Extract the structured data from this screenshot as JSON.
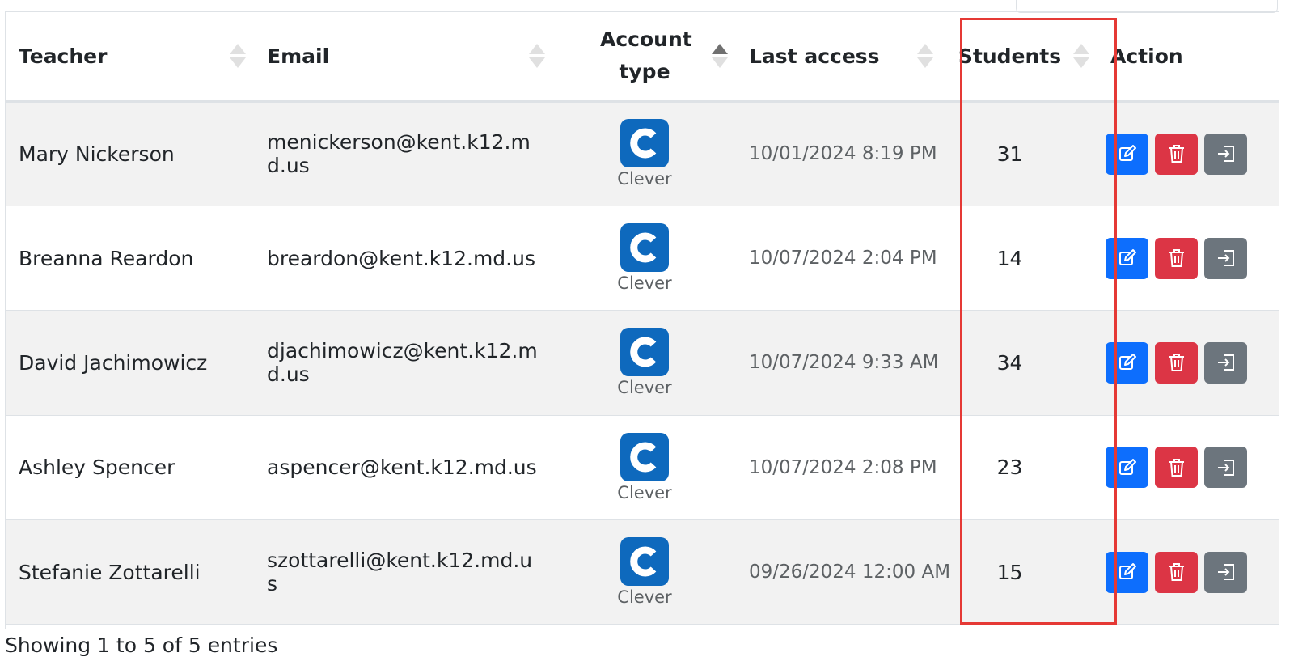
{
  "table": {
    "columns": [
      {
        "label": "Teacher"
      },
      {
        "label": "Email"
      },
      {
        "label": "Account type"
      },
      {
        "label": "Last access"
      },
      {
        "label": "Students"
      },
      {
        "label": "Action"
      }
    ],
    "rows": [
      {
        "teacher": "Mary Nickerson",
        "email": "menickerson@kent.k12.md.us",
        "account_type": "Clever",
        "last_access": "10/01/2024 8:19 PM",
        "students": "31"
      },
      {
        "teacher": "Breanna Reardon",
        "email": "breardon@kent.k12.md.us",
        "account_type": "Clever",
        "last_access": "10/07/2024 2:04 PM",
        "students": "14"
      },
      {
        "teacher": "David Jachimowicz",
        "email": "djachimowicz@kent.k12.md.us",
        "account_type": "Clever",
        "last_access": "10/07/2024 9:33 AM",
        "students": "34"
      },
      {
        "teacher": "Ashley Spencer",
        "email": "aspencer@kent.k12.md.us",
        "account_type": "Clever",
        "last_access": "10/07/2024 2:08 PM",
        "students": "23"
      },
      {
        "teacher": "Stefanie Zottarelli",
        "email": "szottarelli@kent.k12.md.us",
        "account_type": "Clever",
        "last_access": "09/26/2024 12:00 AM",
        "students": "15"
      }
    ]
  },
  "footer": {
    "info": "Showing 1 to 5 of 5 entries"
  },
  "colors": {
    "edit": "#0d6efd",
    "delete": "#dc3545",
    "login": "#6c757d",
    "clever_brand": "#0e69bd",
    "highlight": "#e53935"
  },
  "icons": {
    "edit": "edit-icon",
    "delete": "trash-icon",
    "login": "login-icon",
    "account": "clever-logo-icon"
  }
}
